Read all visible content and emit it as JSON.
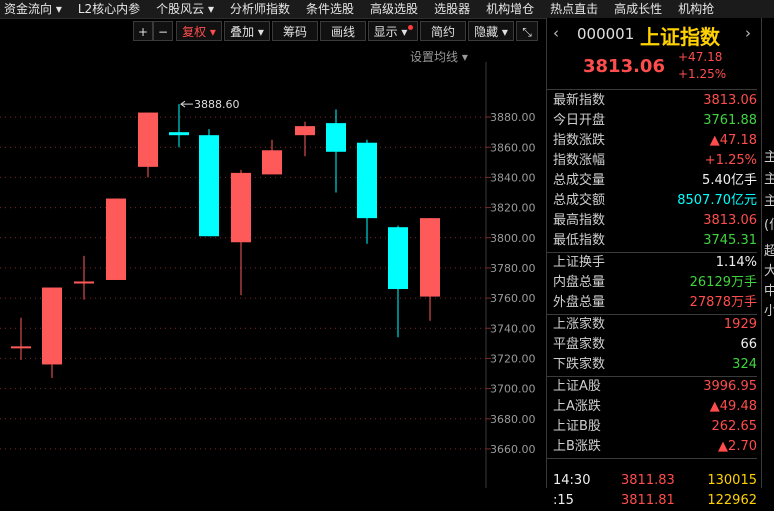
{
  "topnav": [
    {
      "label": "资金流向",
      "arrow": "▾"
    },
    {
      "label": "L2核心内参",
      "arrow": ""
    },
    {
      "label": "个股风云",
      "arrow": "▾"
    },
    {
      "label": "分析师指数",
      "arrow": ""
    },
    {
      "label": "条件选股",
      "arrow": ""
    },
    {
      "label": "高级选股",
      "arrow": ""
    },
    {
      "label": "选股器",
      "arrow": ""
    },
    {
      "label": "机构增仓",
      "arrow": ""
    },
    {
      "label": "热点直击",
      "arrow": ""
    },
    {
      "label": "高成长性",
      "arrow": ""
    },
    {
      "label": "机构抢",
      "arrow": ""
    }
  ],
  "toolbar": {
    "plus": "+",
    "minus": "−",
    "fuquan": "复权 ▾",
    "diejia": "叠加 ▾",
    "chouma": "筹码",
    "huaxian": "画线",
    "xianshi": "显示 ▾",
    "jianyue": "简约",
    "yincang": "隐藏 ▾",
    "expand": "⤡"
  },
  "settings_label": "设置均线 ▾",
  "chart_data": {
    "type": "candlestick",
    "ylim": [
      3650,
      3890
    ],
    "yticks": [
      "3880.00",
      "3860.00",
      "3840.00",
      "3820.00",
      "3800.00",
      "3780.00",
      "3760.00",
      "3740.00",
      "3720.00",
      "3700.00",
      "3680.00",
      "3660.00"
    ],
    "candles": [
      {
        "o": 3728,
        "c": 3728,
        "h": 3747,
        "l": 3719
      },
      {
        "o": 3716,
        "c": 3767,
        "h": 3767,
        "l": 3707
      },
      {
        "o": 3771,
        "c": 3771,
        "h": 3788,
        "l": 3759
      },
      {
        "o": 3772,
        "c": 3826,
        "h": 3826,
        "l": 3772
      },
      {
        "o": 3847,
        "c": 3883,
        "h": 3883,
        "l": 3840
      },
      {
        "o": 3870,
        "c": 3868,
        "h": 3888.6,
        "l": 3860
      },
      {
        "o": 3868,
        "c": 3801,
        "h": 3872,
        "l": 3801
      },
      {
        "o": 3797,
        "c": 3843,
        "h": 3845,
        "l": 3762
      },
      {
        "o": 3842,
        "c": 3858,
        "h": 3865,
        "l": 3842
      },
      {
        "o": 3868,
        "c": 3874,
        "h": 3877,
        "l": 3854
      },
      {
        "o": 3876,
        "c": 3857,
        "h": 3885,
        "l": 3830
      },
      {
        "o": 3863,
        "c": 3813,
        "h": 3865,
        "l": 3796
      },
      {
        "o": 3807,
        "c": 3766,
        "h": 3808,
        "l": 3734
      },
      {
        "o": 3761,
        "c": 3813,
        "h": 3813,
        "l": 3745
      }
    ],
    "high_label": "3888.60"
  },
  "quote": {
    "code": "000001",
    "name": "上证指数",
    "price": "3813.06",
    "change": "+47.18",
    "pct": "+1.25%"
  },
  "rows1": [
    {
      "label": "最新指数",
      "value": "3813.06",
      "color": "#ff4d4d"
    },
    {
      "label": "今日开盘",
      "value": "3761.88",
      "color": "#3fd43f"
    },
    {
      "label": "指数涨跌",
      "value": "▲47.18",
      "color": "#ff4d4d"
    },
    {
      "label": "指数涨幅",
      "value": "+1.25%",
      "color": "#ff4d4d"
    },
    {
      "label": "总成交量",
      "value": "5.40亿手",
      "color": "#f0f0f0"
    },
    {
      "label": "总成交额",
      "value": "8507.70亿元",
      "color": "#00ffff"
    },
    {
      "label": "最高指数",
      "value": "3813.06",
      "color": "#ff4d4d"
    },
    {
      "label": "最低指数",
      "value": "3745.31",
      "color": "#3fd43f"
    }
  ],
  "rows2": [
    {
      "label": "上证换手",
      "value": "1.14%",
      "color": "#f0f0f0"
    },
    {
      "label": "内盘总量",
      "value": "26129万手",
      "color": "#3fd43f"
    },
    {
      "label": "外盘总量",
      "value": "27878万手",
      "color": "#ff4d4d"
    }
  ],
  "rows3": [
    {
      "label": "上涨家数",
      "value": "1929",
      "color": "#ff4d4d"
    },
    {
      "label": "平盘家数",
      "value": "66",
      "color": "#f0f0f0"
    },
    {
      "label": "下跌家数",
      "value": "324",
      "color": "#3fd43f"
    }
  ],
  "rows4": [
    {
      "label": "上证A股",
      "value": "3996.95",
      "color": "#ff4d4d"
    },
    {
      "label": "上A涨跌",
      "value": "▲49.48",
      "color": "#ff4d4d"
    },
    {
      "label": "上证B股",
      "value": "262.65",
      "color": "#ff4d4d"
    },
    {
      "label": "上B涨跌",
      "value": "▲2.70",
      "color": "#ff4d4d"
    }
  ],
  "ticks": [
    {
      "time": "14:30",
      "price": "3811.83",
      "vol": "130015"
    },
    {
      "time": ":15",
      "price": "3811.81",
      "vol": "122962"
    }
  ],
  "side_chars": [
    "主",
    "主",
    "主",
    "(亿",
    "超",
    "大",
    "中",
    "小"
  ]
}
